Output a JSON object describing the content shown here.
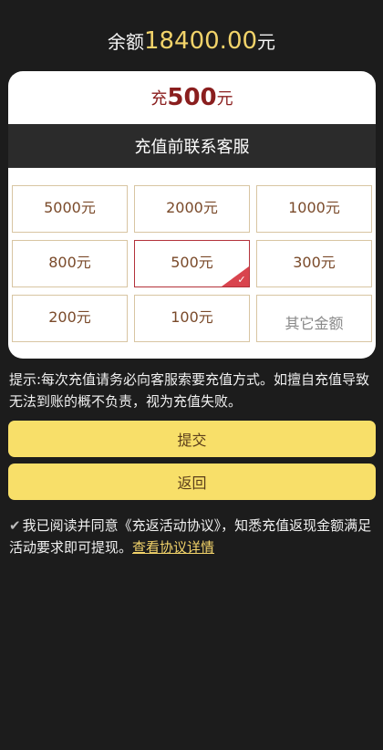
{
  "balance": {
    "prefix": "余额",
    "amount": "18400.00",
    "unit": "元"
  },
  "card": {
    "recharge_prefix": "充",
    "recharge_amount": "500",
    "recharge_unit": "元",
    "service_label": "充值前联系客服",
    "options": [
      {
        "label": "5000元",
        "selected": false
      },
      {
        "label": "2000元",
        "selected": false
      },
      {
        "label": "1000元",
        "selected": false
      },
      {
        "label": "800元",
        "selected": false
      },
      {
        "label": "500元",
        "selected": true
      },
      {
        "label": "300元",
        "selected": false
      },
      {
        "label": "200元",
        "selected": false
      },
      {
        "label": "100元",
        "selected": false
      },
      {
        "label": "其它金额",
        "selected": false
      }
    ]
  },
  "tip": "提示:每次充值请务必向客服索要充值方式。如擅自充值导致无法到账的概不负责，视为充值失败。",
  "buttons": {
    "submit": "提交",
    "back": "返回"
  },
  "agreement": {
    "checked": true,
    "text": "我已阅读并同意《充返活动协议》，知悉充值返现金额满足活动要求即可提现。",
    "link_text": "查看协议详情"
  },
  "colors": {
    "accent_gold": "#f2d36a",
    "button_yellow": "#f8df69",
    "selected_red": "#d9444e",
    "dark_bg": "#1c1c1c"
  }
}
